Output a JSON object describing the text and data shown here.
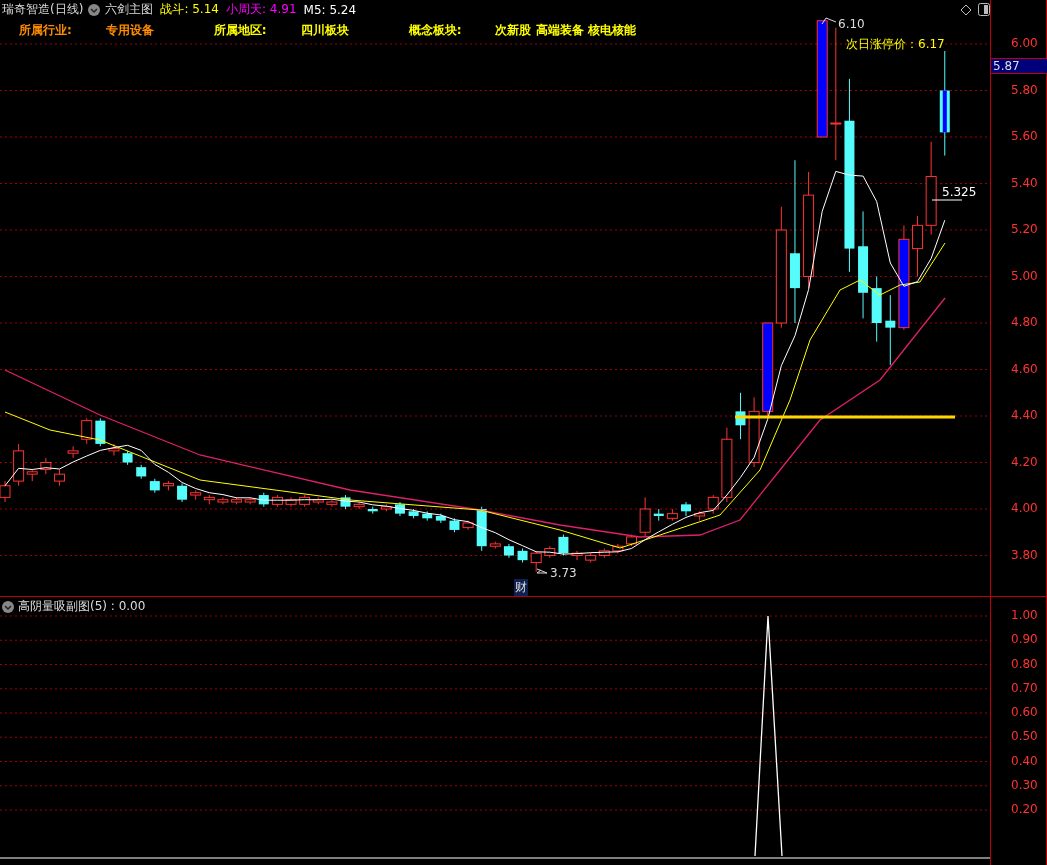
{
  "header": {
    "stock": "瑞奇智造(日线)",
    "indicator": "六剑主图",
    "values": [
      {
        "text": "战斗: 5.14",
        "color": "#ffff00"
      },
      {
        "text": "小周天: 4.91",
        "color": "#ff00ff"
      },
      {
        "text": "M5: 5.24",
        "color": "#ffffff"
      }
    ]
  },
  "info": [
    {
      "label": "所属行业:",
      "value": "专用设备",
      "color": "#ff8c00"
    },
    {
      "label": "所属地区:",
      "value": "四川板块",
      "color": "#ffff00"
    },
    {
      "label": "概念板块:",
      "value": "次新股 高端装备 核电核能",
      "color": "#ffff00"
    }
  ],
  "annotations": {
    "high": "6.10",
    "limit_price": "次日涨停价：6.17",
    "level_mark": "5.325",
    "low": "3.73",
    "marker": "财"
  },
  "price_axis": {
    "ticks": [
      "6.00",
      "5.80",
      "5.60",
      "5.40",
      "5.20",
      "5.00",
      "4.80",
      "4.60",
      "4.40",
      "4.20",
      "4.00",
      "3.80"
    ],
    "current_price": "5.87"
  },
  "sub_panel": {
    "title": "高阴量吸副图(5) : 0.00",
    "ticks": [
      "1.00",
      "0.90",
      "0.80",
      "0.70",
      "0.60",
      "0.50",
      "0.40",
      "0.30",
      "0.20"
    ]
  }
}
